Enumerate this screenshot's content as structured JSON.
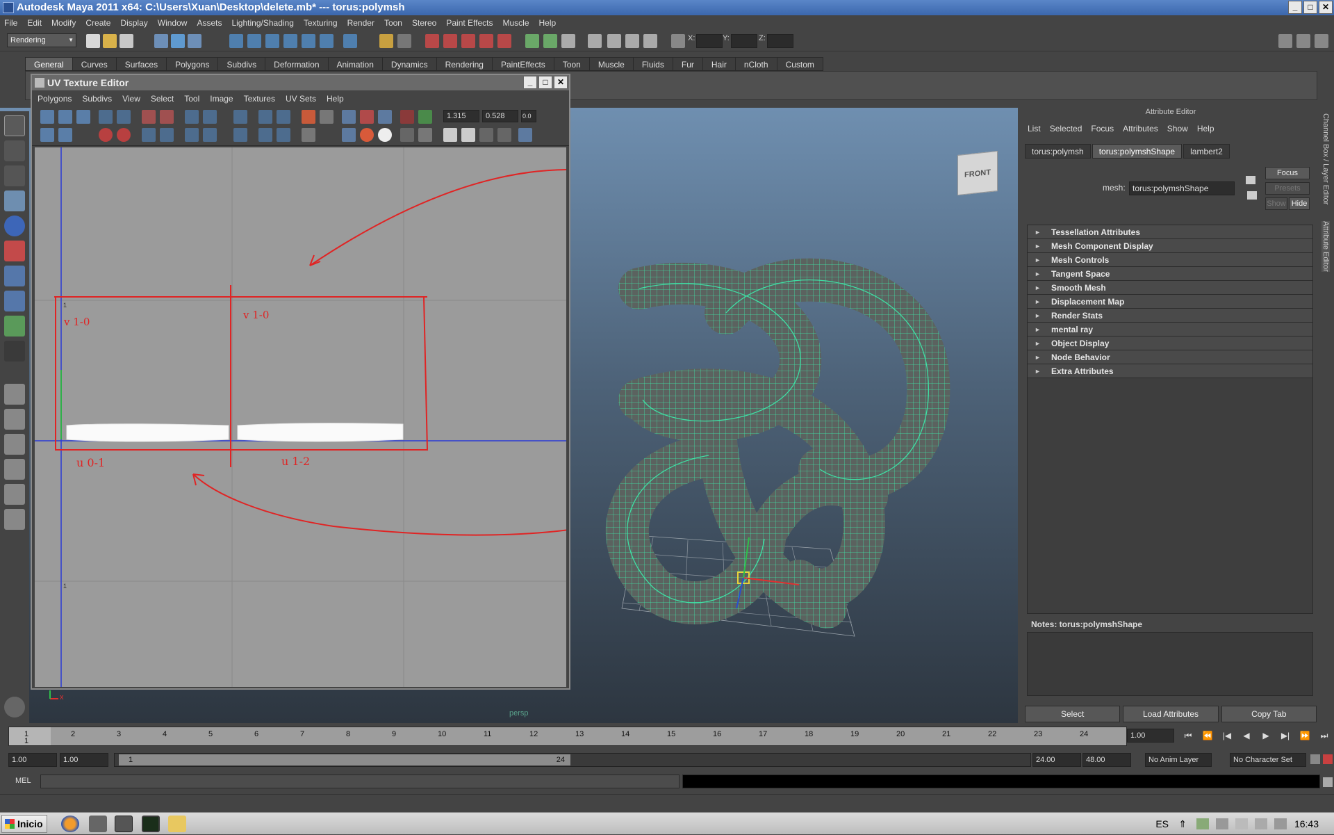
{
  "window": {
    "title": "Autodesk Maya 2011 x64: C:\\Users\\Xuan\\Desktop\\delete.mb*   ---   torus:polymsh",
    "min": "_",
    "max": "□",
    "close": "✕"
  },
  "menubar": [
    "File",
    "Edit",
    "Modify",
    "Create",
    "Display",
    "Window",
    "Assets",
    "Lighting/Shading",
    "Texturing",
    "Render",
    "Toon",
    "Stereo",
    "Paint Effects",
    "Muscle",
    "Help"
  ],
  "statusline": {
    "mode": "Rendering",
    "x_label": "X:",
    "y_label": "Y:",
    "z_label": "Z:"
  },
  "shelf_tabs": [
    "General",
    "Curves",
    "Surfaces",
    "Polygons",
    "Subdivs",
    "Deformation",
    "Animation",
    "Dynamics",
    "Rendering",
    "PaintEffects",
    "Toon",
    "Muscle",
    "Fluids",
    "Fur",
    "Hair",
    "nCloth",
    "Custom"
  ],
  "shelf_active": "General",
  "viewport": {
    "camera_label": "persp",
    "viewcube_label": "FRONT",
    "axis_x": "x"
  },
  "uv_editor": {
    "title": "UV Texture Editor",
    "menu": [
      "Polygons",
      "Subdivs",
      "View",
      "Select",
      "Tool",
      "Image",
      "Textures",
      "UV Sets",
      "Help"
    ],
    "field1": "1.315",
    "field2": "0.528",
    "field3": "0.0",
    "axis_label_top": "1",
    "axis_label_bottom": "1",
    "annotations": {
      "v_left": "v 1-0",
      "v_right": "v 1-0",
      "u_left": "u 0-1",
      "u_right": "u 1-2"
    }
  },
  "attribute_editor": {
    "header": "Attribute Editor",
    "menu": [
      "List",
      "Selected",
      "Focus",
      "Attributes",
      "Show",
      "Help"
    ],
    "tabs": [
      "torus:polymsh",
      "torus:polymshShape",
      "lambert2"
    ],
    "active_tab": "torus:polymshShape",
    "mesh_label": "mesh:",
    "mesh_value": "torus:polymshShape",
    "focus_btn": "Focus",
    "presets_btn": "Presets",
    "show_btn": "Show",
    "hide_btn": "Hide",
    "sections": [
      "Tessellation Attributes",
      "Mesh Component Display",
      "Mesh Controls",
      "Tangent Space",
      "Smooth Mesh",
      "Displacement Map",
      "Render Stats",
      "mental ray",
      "Object Display",
      "Node Behavior",
      "Extra Attributes"
    ],
    "notes_label": "Notes:  torus:polymshShape",
    "buttons": [
      "Select",
      "Load Attributes",
      "Copy Tab"
    ]
  },
  "side_tabs": {
    "channel_box": "Channel Box / Layer Editor",
    "attr_editor": "Attribute Editor"
  },
  "timeslider": {
    "ticks": [
      "1",
      "2",
      "3",
      "4",
      "5",
      "6",
      "7",
      "8",
      "9",
      "10",
      "11",
      "12",
      "13",
      "14",
      "15",
      "16",
      "17",
      "18",
      "19",
      "20",
      "21",
      "22",
      "23",
      "24"
    ],
    "current_frame_marker": "1",
    "current_frame": "1.00"
  },
  "rangeslider": {
    "start": "1.00",
    "start2": "1.00",
    "range_start": "1",
    "range_end": "24",
    "end": "24.00",
    "end2": "48.00",
    "anim_layer": "No Anim Layer",
    "char_set": "No Character Set"
  },
  "cmdline": {
    "label": "MEL"
  },
  "taskbar": {
    "start": "Inicio",
    "lang": "ES",
    "clock": "16:43"
  }
}
